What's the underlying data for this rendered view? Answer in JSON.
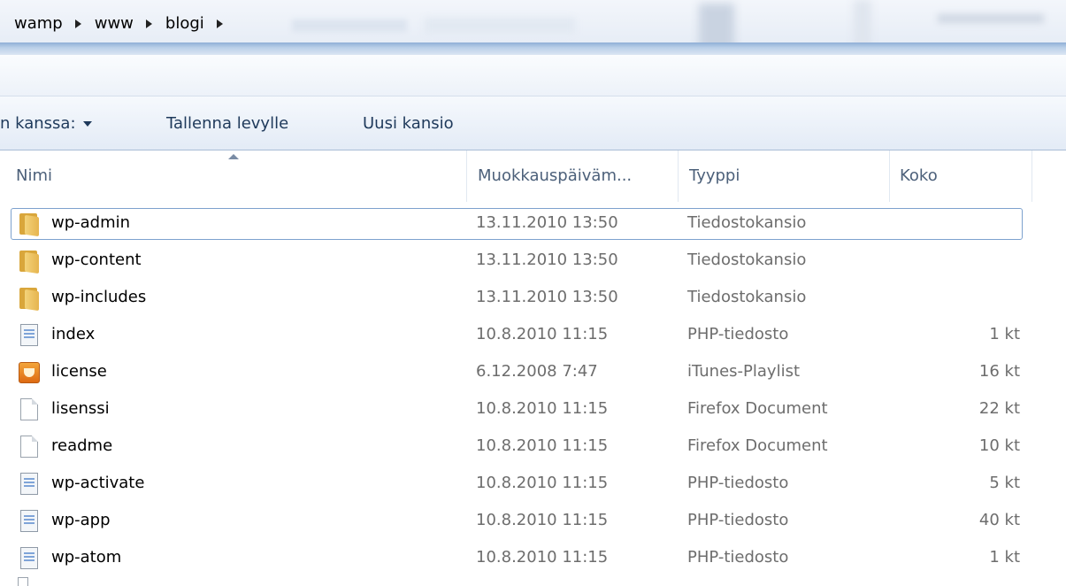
{
  "breadcrumb": [
    "wamp",
    "www",
    "blogi"
  ],
  "toolbar": {
    "share_label": "n kanssa:",
    "save_label": "Tallenna levylle",
    "new_folder_label": "Uusi kansio"
  },
  "columns": {
    "name": "Nimi",
    "date": "Muokkauspäiväm...",
    "type": "Tyyppi",
    "size": "Koko"
  },
  "files": [
    {
      "name": "wp-admin",
      "date": "13.11.2010 13:50",
      "type": "Tiedostokansio",
      "size": "",
      "icon": "folder-icon"
    },
    {
      "name": "wp-content",
      "date": "13.11.2010 13:50",
      "type": "Tiedostokansio",
      "size": "",
      "icon": "folder-icon"
    },
    {
      "name": "wp-includes",
      "date": "13.11.2010 13:50",
      "type": "Tiedostokansio",
      "size": "",
      "icon": "folder-icon"
    },
    {
      "name": "index",
      "date": "10.8.2010 11:15",
      "type": "PHP-tiedosto",
      "size": "1 kt",
      "icon": "php-file-icon"
    },
    {
      "name": "license",
      "date": "6.12.2008 7:47",
      "type": "iTunes-Playlist",
      "size": "16 kt",
      "icon": "itunes-playlist-icon"
    },
    {
      "name": "lisenssi",
      "date": "10.8.2010 11:15",
      "type": "Firefox Document",
      "size": "22 kt",
      "icon": "document-icon"
    },
    {
      "name": "readme",
      "date": "10.8.2010 11:15",
      "type": "Firefox Document",
      "size": "10 kt",
      "icon": "document-icon"
    },
    {
      "name": "wp-activate",
      "date": "10.8.2010 11:15",
      "type": "PHP-tiedosto",
      "size": "5 kt",
      "icon": "php-file-icon"
    },
    {
      "name": "wp-app",
      "date": "10.8.2010 11:15",
      "type": "PHP-tiedosto",
      "size": "40 kt",
      "icon": "php-file-icon"
    },
    {
      "name": "wp-atom",
      "date": "10.8.2010 11:15",
      "type": "PHP-tiedosto",
      "size": "1 kt",
      "icon": "php-file-icon"
    }
  ]
}
